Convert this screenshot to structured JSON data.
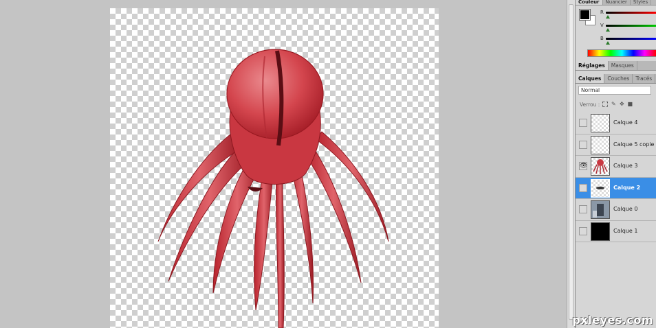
{
  "color_panel": {
    "tabs": [
      "Couleur",
      "Nuancier",
      "Styles"
    ],
    "sliders": [
      {
        "label": "R",
        "gradient": "linear-gradient(to right,#000,#ff0000)"
      },
      {
        "label": "V",
        "gradient": "linear-gradient(to right,#000,#00cc00)"
      },
      {
        "label": "B",
        "gradient": "linear-gradient(to right,#000,#0000ff)"
      }
    ],
    "foreground": "#000000",
    "background": "#ffffff"
  },
  "adjustments_panel": {
    "tabs": [
      "Réglages",
      "Masques"
    ]
  },
  "layers_panel": {
    "tabs": [
      "Calques",
      "Couches",
      "Tracés"
    ],
    "blend_mode": "Normal",
    "lock_label": "Verrou :",
    "layers": [
      {
        "name": "Calque 4",
        "visible": false,
        "selected": false,
        "thumb": "transparent"
      },
      {
        "name": "Calque 5 copie",
        "visible": false,
        "selected": false,
        "thumb": "transparent"
      },
      {
        "name": "Calque 3",
        "visible": true,
        "selected": false,
        "thumb": "octopus"
      },
      {
        "name": "Calque 2",
        "visible": false,
        "selected": true,
        "thumb": "eye-shape"
      },
      {
        "name": "Calque 0",
        "visible": false,
        "selected": false,
        "thumb": "photo"
      },
      {
        "name": "Calque 1",
        "visible": false,
        "selected": false,
        "thumb": "black"
      }
    ]
  },
  "watermark": "pxleyes.com",
  "colors": {
    "accent_selected": "#3a8ee6",
    "octopus_red": "#c9353f"
  }
}
